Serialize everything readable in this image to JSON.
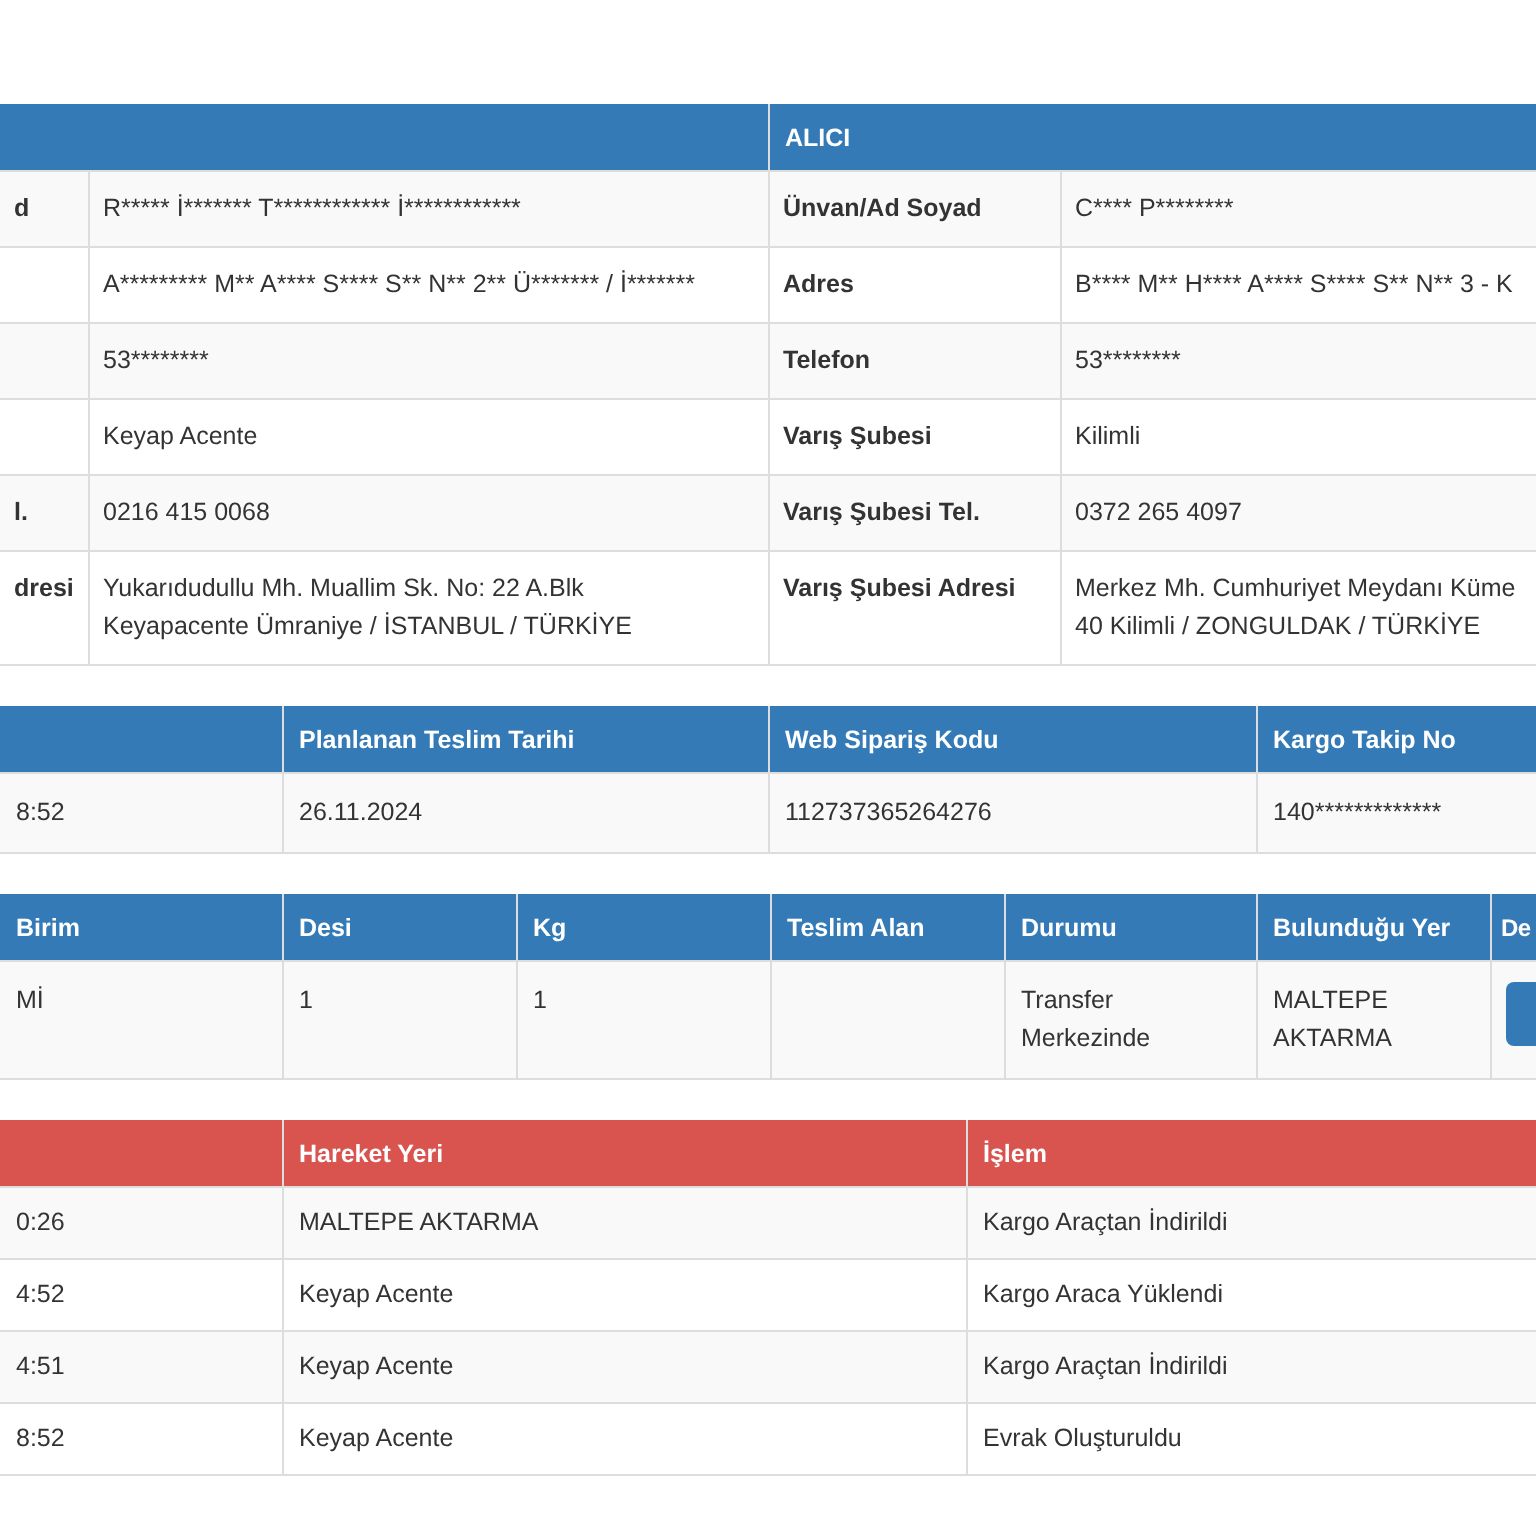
{
  "parties": {
    "kind": "info",
    "columns": [
      null,
      null,
      "ALICI",
      null
    ],
    "rows": [
      [
        "d",
        "R***** İ******* T************ İ************",
        "Ünvan/Ad Soyad",
        "C**** P********"
      ],
      [
        null,
        "A********* M** A**** S**** S** N** 2** Ü******* / İ*******",
        "Adres",
        "B**** M** H**** A**** S**** S** N** 3 - K"
      ],
      [
        null,
        "53********",
        "Telefon",
        "53********"
      ],
      [
        null,
        "Keyap Acente",
        "Varış Şubesi",
        "Kilimli"
      ],
      [
        "l.",
        "0216 415 0068",
        "Varış Şubesi Tel.",
        "0372 265 4097"
      ],
      [
        "dresi",
        "Yukarıdudullu Mh. Muallim Sk. No: 22 A.Blk\nKeyapacente Ümraniye / İSTANBUL / TÜRKİYE",
        "Varış Şubesi Adresi",
        "Merkez Mh. Cumhuriyet Meydanı Küme\n40 Kilimli / ZONGULDAK / TÜRKİYE"
      ]
    ]
  },
  "order": {
    "kind": "info",
    "columns": [
      null,
      "Planlanan Teslim Tarihi",
      "Web Sipariş Kodu",
      "Kargo Takip No"
    ],
    "rows": [
      [
        "8:52",
        "26.11.2024",
        "112737365264276",
        "140*************"
      ]
    ]
  },
  "shipment": {
    "kind": "info",
    "columns": [
      "Birim",
      "Desi",
      "Kg",
      "Teslim Alan",
      "Durumu",
      "Bulunduğu Yer",
      "De"
    ],
    "rows": [
      [
        "Mİ",
        "1",
        "1",
        null,
        "Transfer\nMerkezinde",
        "MALTEPE\nAKTARMA",
        {
          "kind": "button"
        }
      ]
    ]
  },
  "movements": {
    "kind": "danger",
    "columns": [
      null,
      "Hareket Yeri",
      "İşlem"
    ],
    "rows": [
      [
        "0:26",
        "MALTEPE AKTARMA",
        "Kargo Araçtan İndirildi"
      ],
      [
        "4:52",
        "Keyap Acente",
        "Kargo Araca Yüklendi"
      ],
      [
        "4:51",
        "Keyap Acente",
        "Kargo Araçtan İndirildi"
      ],
      [
        "8:52",
        "Keyap Acente",
        "Evrak Oluşturuldu"
      ]
    ]
  }
}
